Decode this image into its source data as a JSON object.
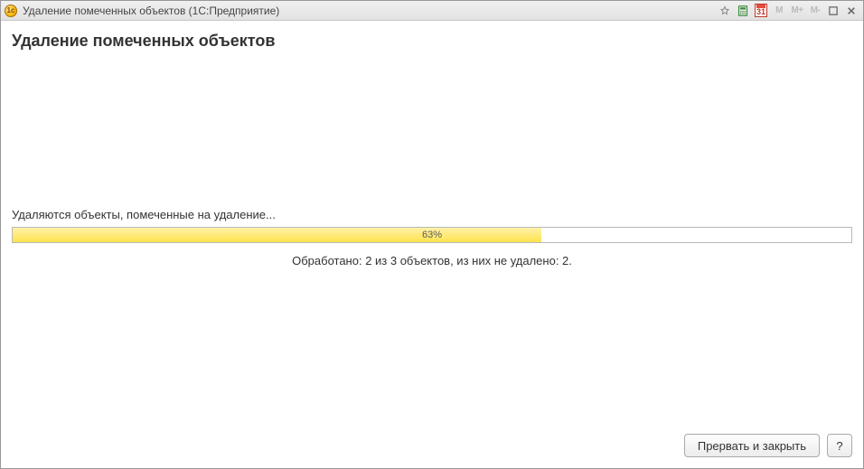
{
  "titlebar": {
    "title": "Удаление помеченных объектов  (1С:Предприятие)",
    "calendar_day": "31",
    "m_labels": {
      "m": "M",
      "mplus": "M+",
      "mminus": "M-"
    }
  },
  "page": {
    "heading": "Удаление помеченных объектов",
    "status": "Удаляются объекты, помеченные на удаление...",
    "progress": {
      "percent": 63,
      "label": "63%"
    },
    "summary": "Обработано: 2 из 3 объектов, из них не удалено: 2."
  },
  "footer": {
    "abort_label": "Прервать и закрыть",
    "help_label": "?"
  }
}
